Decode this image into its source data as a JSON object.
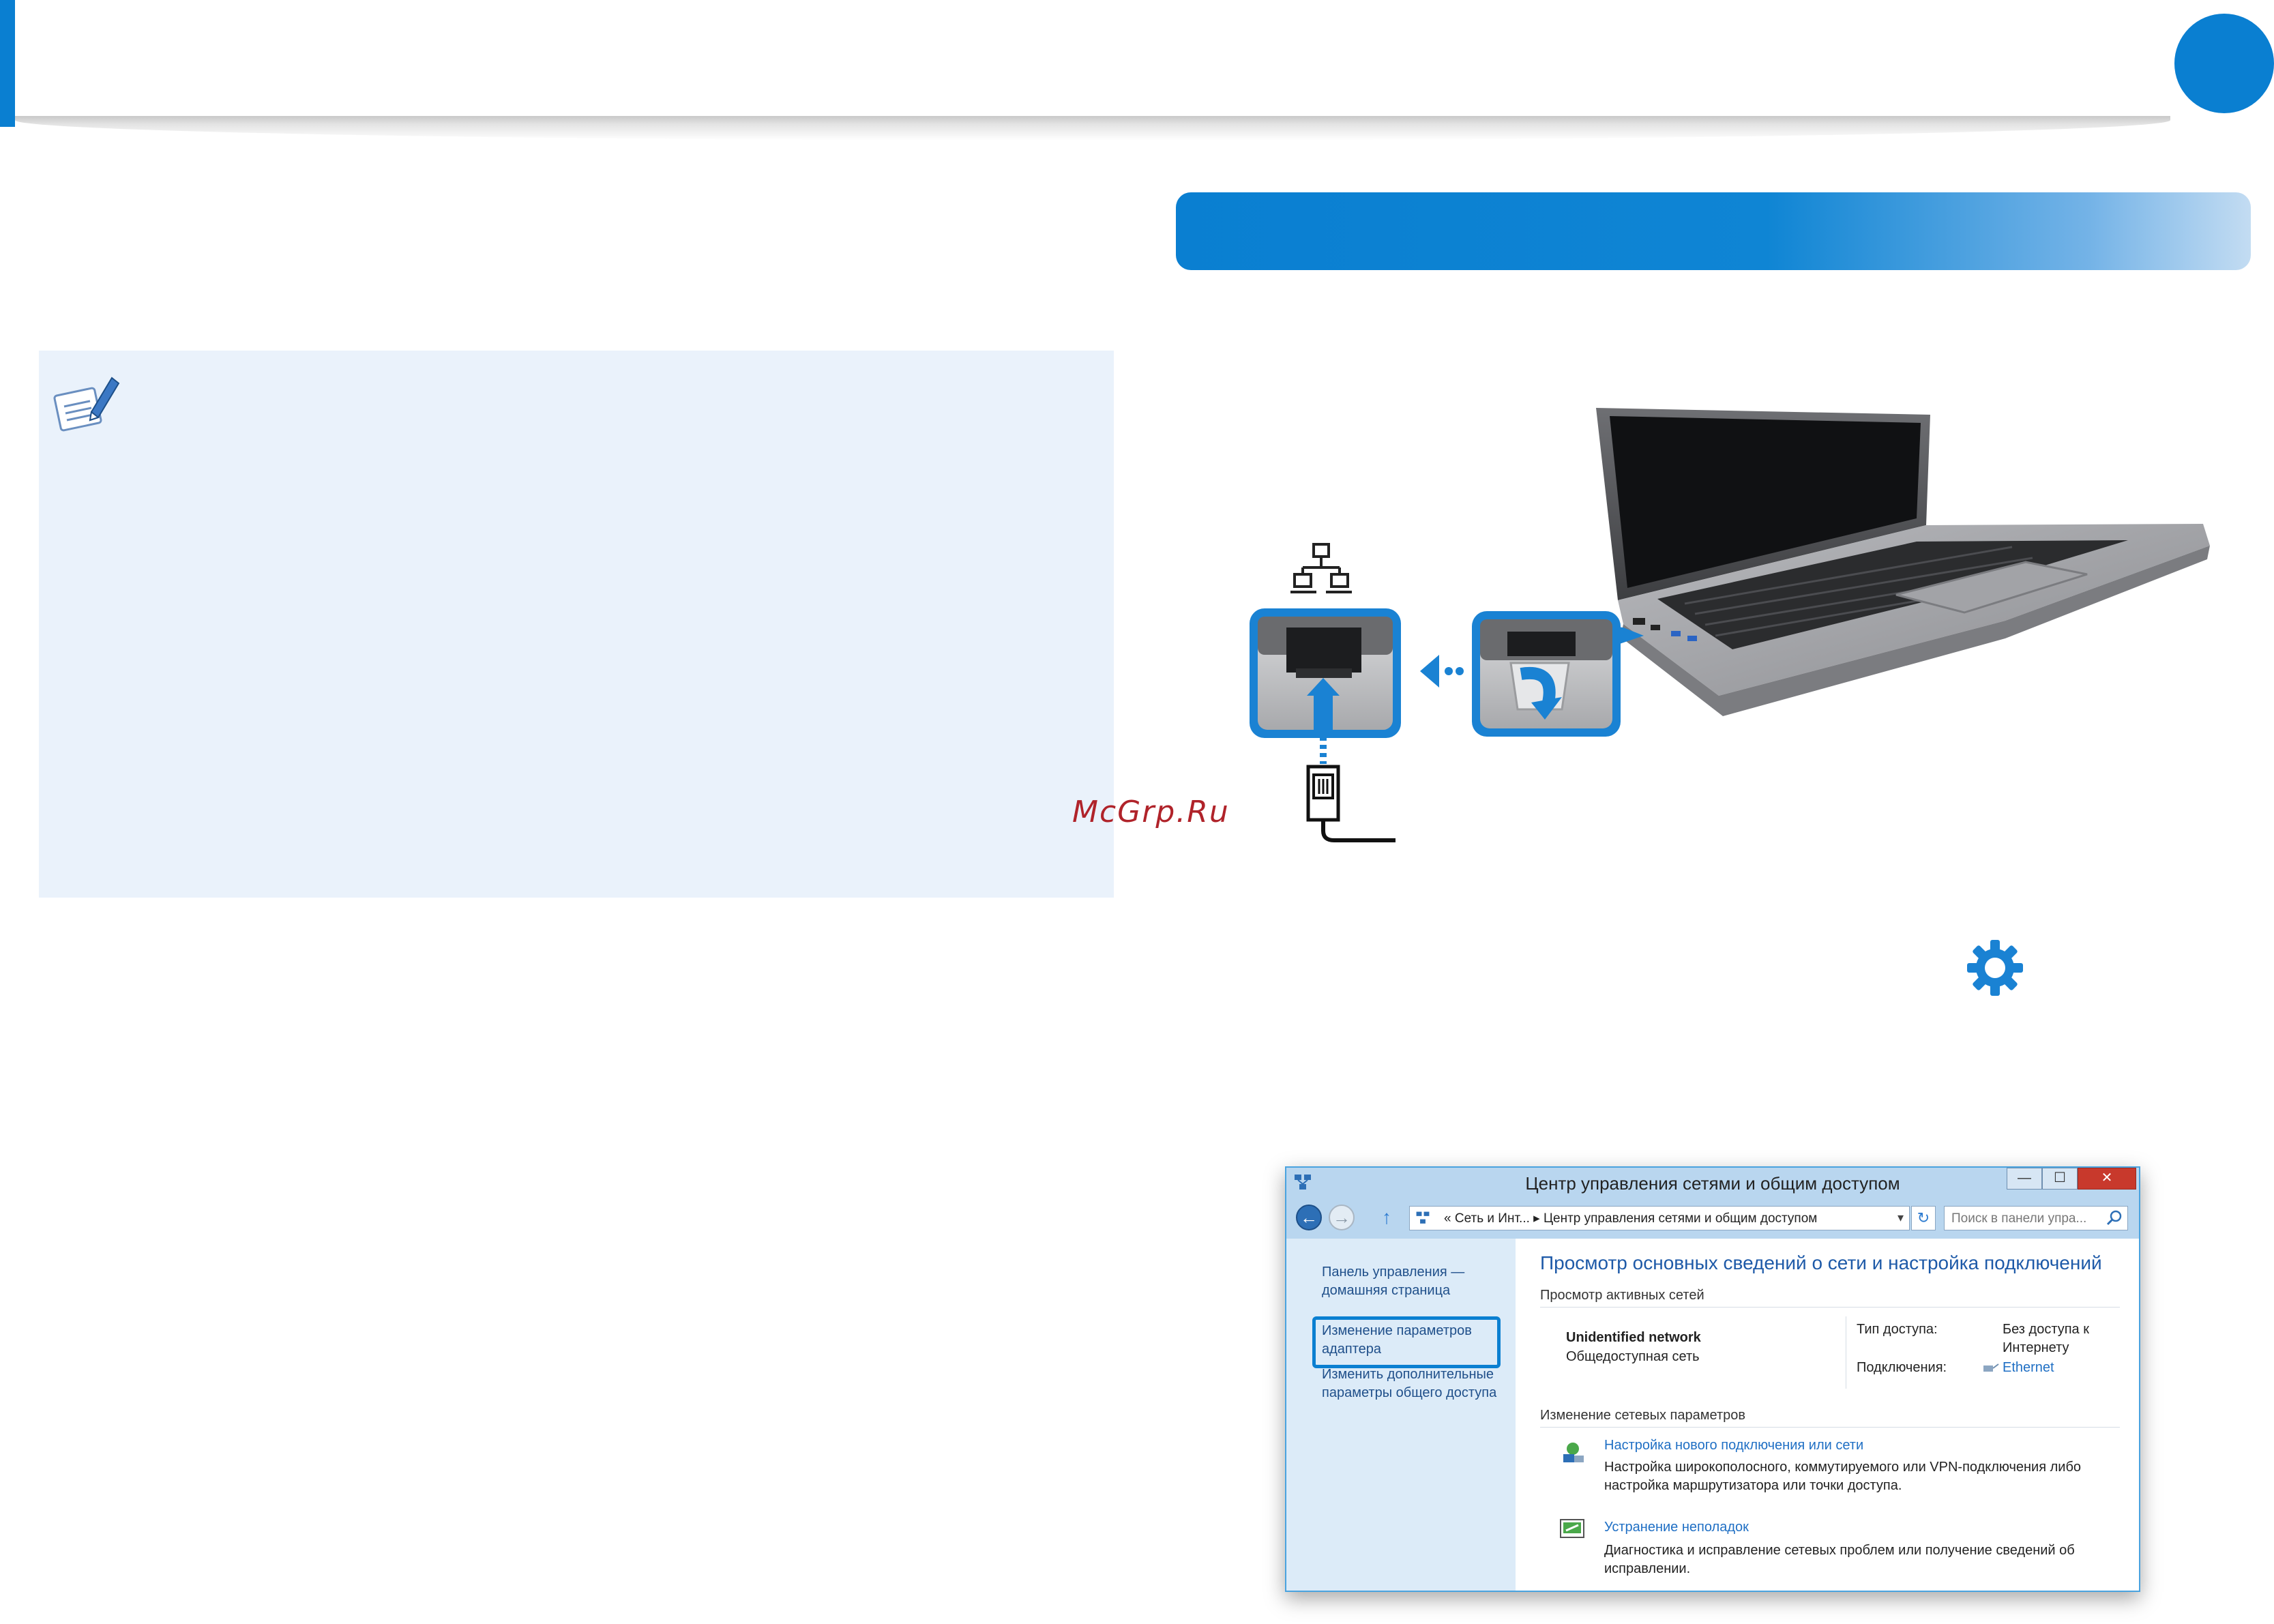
{
  "watermark": "McGrp.Ru",
  "window": {
    "title": "Центр управления сетями и общим доступом",
    "min_label": "—",
    "max_label": "☐",
    "close_label": "✕",
    "address": {
      "separator": "«",
      "crumb1": "Сеть и Инт...",
      "arrow": "▸",
      "crumb2": "Центр управления сетями и общим доступом"
    },
    "search_placeholder": "Поиск в панели упра...",
    "left_pane": {
      "home_line1": "Панель управления —",
      "home_line2": "домашняя страница",
      "adapter_line1": "Изменение параметров",
      "adapter_line2": "адаптера",
      "sharing_line1": "Изменить дополнительные",
      "sharing_line2": "параметры общего доступа"
    },
    "main": {
      "title": "Просмотр основных сведений о сети и настройка подключений",
      "active_networks_head": "Просмотр активных сетей",
      "network_name": "Unidentified network",
      "network_type": "Общедоступная сеть",
      "access_label": "Тип доступа:",
      "access_value_line1": "Без доступа к",
      "access_value_line2": "Интернету",
      "connections_label": "Подключения:",
      "connections_value": "Ethernet",
      "change_settings_head": "Изменение сетевых параметров",
      "setup_link": "Настройка нового подключения или сети",
      "setup_desc_line1": "Настройка широкополосного, коммутируемого или VPN-подключения либо",
      "setup_desc_line2": "настройка маршрутизатора или точки доступа.",
      "troubleshoot_link": "Устранение неполадок",
      "troubleshoot_desc_line1": "Диагностика и исправление сетевых проблем или получение сведений об",
      "troubleshoot_desc_line2": "исправлении."
    }
  }
}
